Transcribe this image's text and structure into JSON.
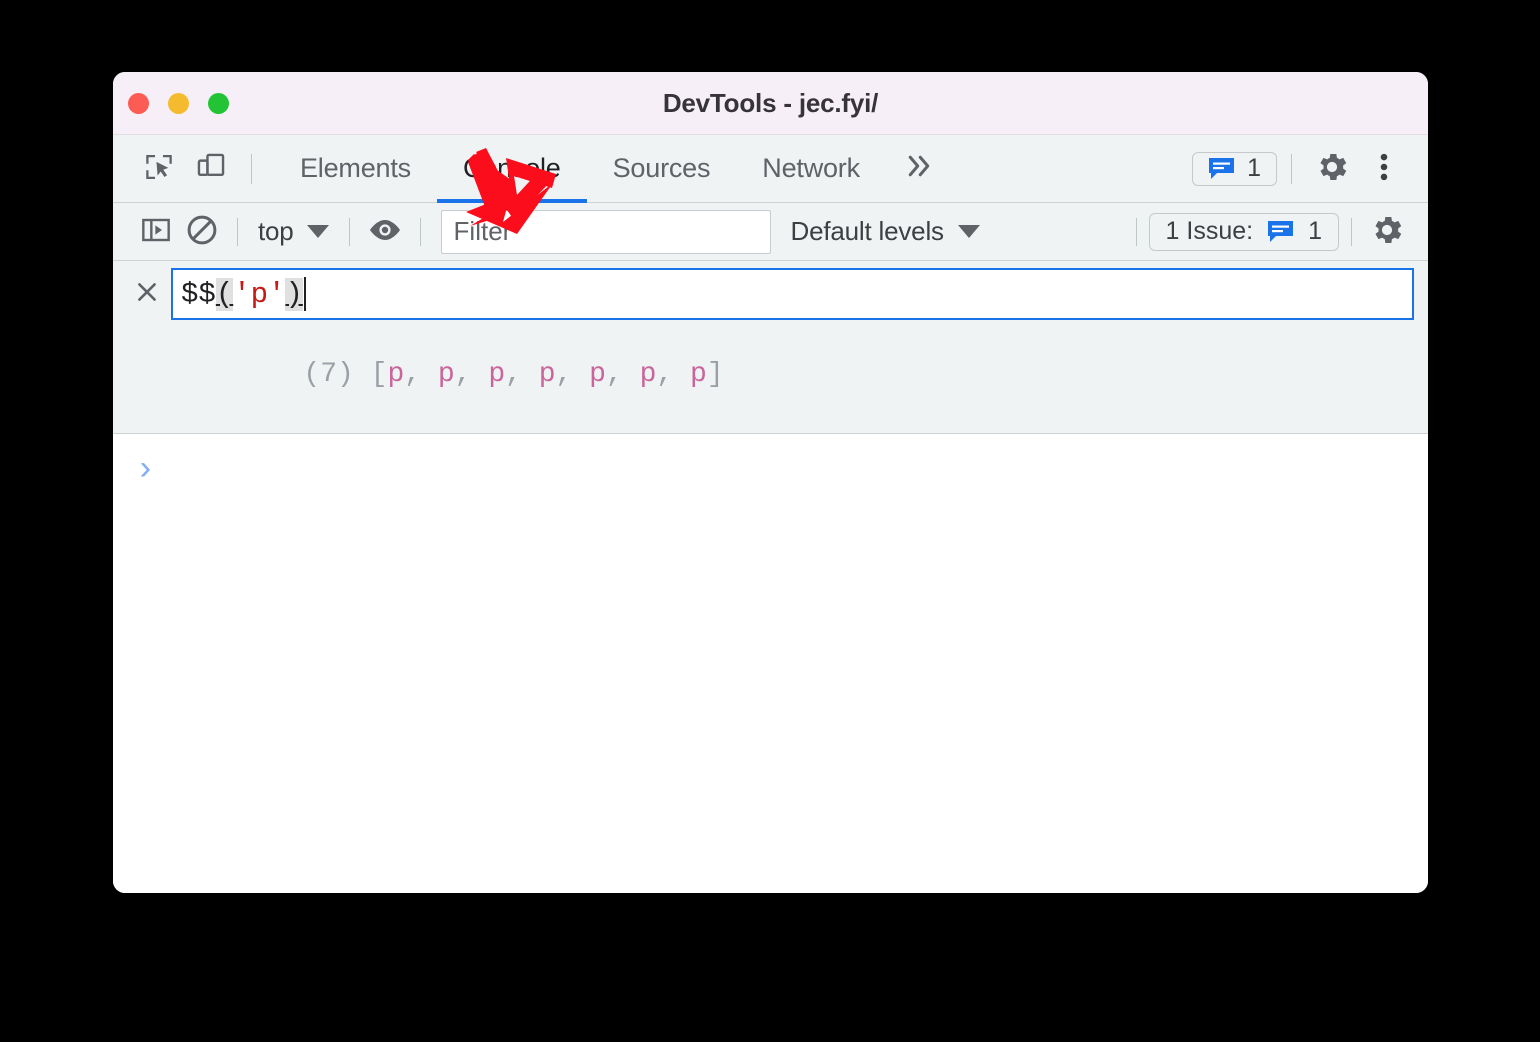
{
  "window": {
    "title": "DevTools - jec.fyi/",
    "traffic_lights": [
      {
        "name": "close",
        "color": "#fc5c54"
      },
      {
        "name": "minimize",
        "color": "#f5bb2e"
      },
      {
        "name": "maximize",
        "color": "#22c436"
      }
    ]
  },
  "tab_bar": {
    "inspect_icon": "inspect-element-icon",
    "device_icon": "device-toolbar-icon",
    "tabs": [
      {
        "label": "Elements",
        "active": false
      },
      {
        "label": "Console",
        "active": true
      },
      {
        "label": "Sources",
        "active": false
      },
      {
        "label": "Network",
        "active": false
      }
    ],
    "more_tabs_label": "»",
    "issues_chip": {
      "icon": "message-bubble-icon",
      "count": "1"
    },
    "settings_icon": "gear-icon",
    "more_options_icon": "kebab-menu-icon",
    "active_underline_color": "#1a73e8"
  },
  "console_toolbar": {
    "sidebar_toggle_icon": "console-sidebar-icon",
    "clear_console_icon": "clear-console-icon",
    "context": {
      "label": "top",
      "caret": "▼"
    },
    "eye_icon": "live-expression-eye-icon",
    "filter": {
      "value": "",
      "placeholder": "Filter"
    },
    "levels": {
      "label": "Default levels",
      "caret": "▼"
    },
    "issues_counter": {
      "label": "1 Issue:",
      "icon": "message-bubble-icon",
      "count": "1"
    },
    "settings_icon": "gear-icon"
  },
  "console_body": {
    "clear_icon": "close-x-icon",
    "input": {
      "tokens": [
        {
          "text": "$$",
          "type": "function"
        },
        {
          "text": "(",
          "type": "bracket"
        },
        {
          "text": "'p'",
          "type": "string"
        },
        {
          "text": ")",
          "type": "bracket"
        }
      ],
      "full_value": "$$('p')"
    },
    "result": {
      "length_label": "(7)",
      "open_bracket": "[",
      "items": [
        "p",
        "p",
        "p",
        "p",
        "p",
        "p",
        "p"
      ],
      "separator": ", ",
      "close_bracket": "]",
      "full_text": "(7) [p, p, p, p, p, p, p]"
    },
    "prompt_chevron": "›"
  },
  "annotation": {
    "arrow_color": "#fc0d1b",
    "direction": "down-left",
    "points_at": "live-expression-eye-icon"
  }
}
